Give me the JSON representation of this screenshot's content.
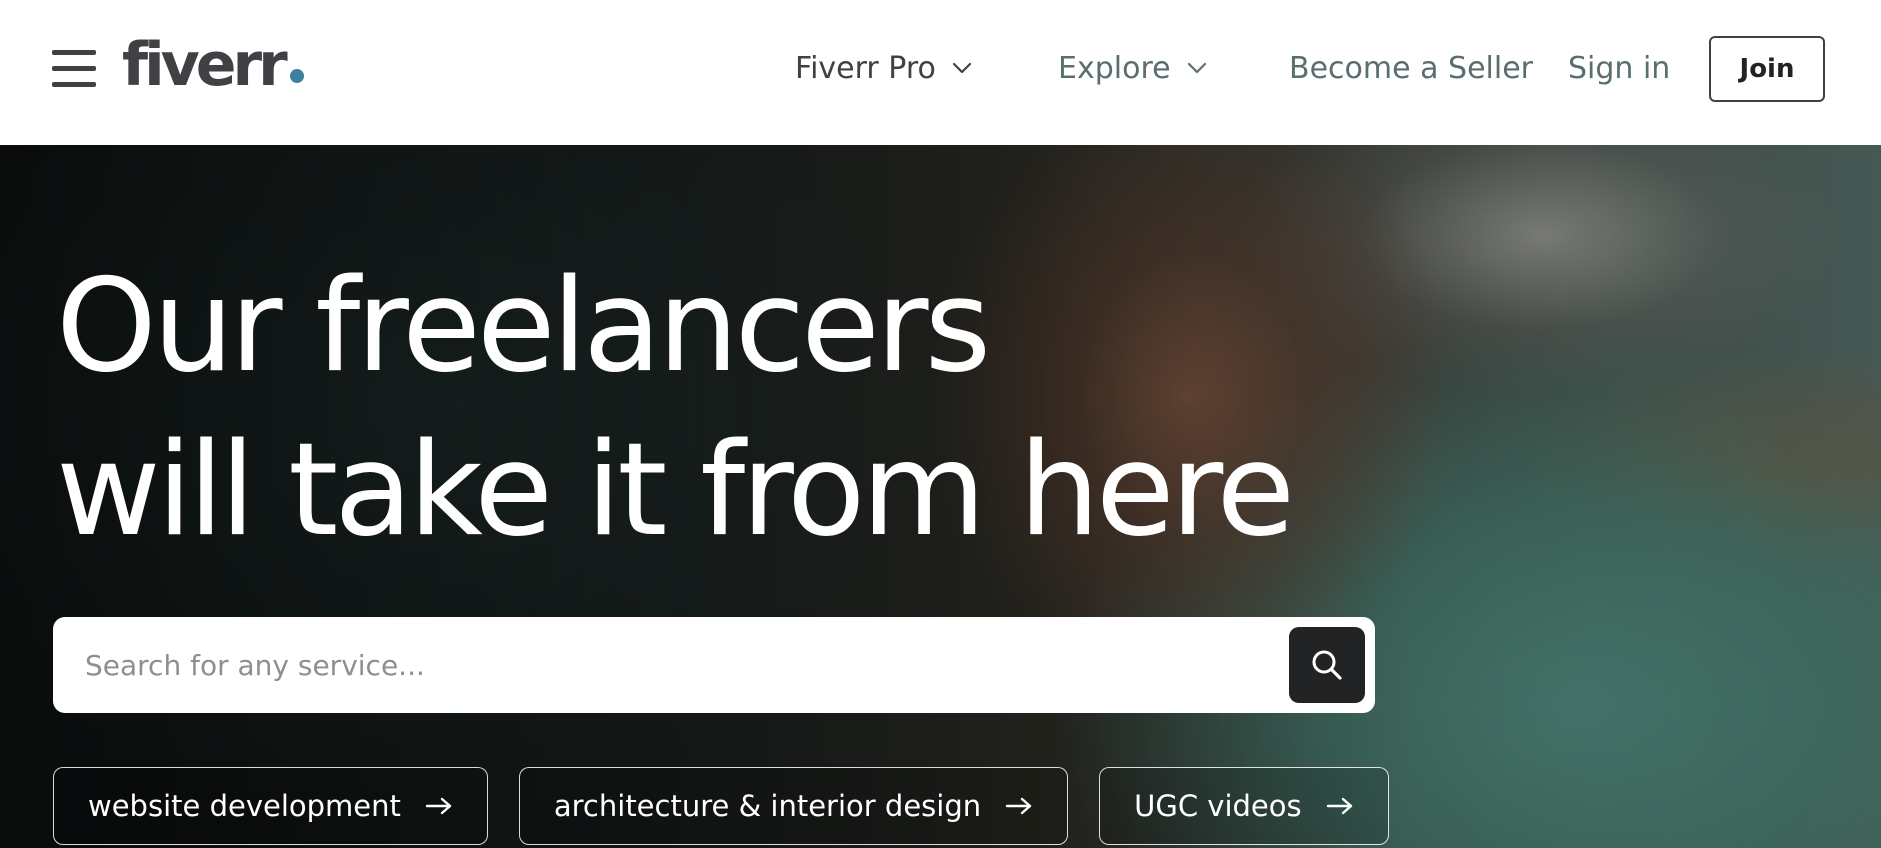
{
  "header": {
    "menu_icon": "hamburger-menu-icon",
    "logo": {
      "text": "fiverr",
      "dot_color": "#3f7f9e"
    },
    "nav": {
      "fiverr_pro": "Fiverr Pro",
      "explore": "Explore",
      "become_seller": "Become a Seller",
      "sign_in": "Sign in",
      "join": "Join"
    }
  },
  "hero": {
    "headline_line1": "Our freelancers",
    "headline_line2": "will take it from here",
    "search": {
      "placeholder": "Search for any service...",
      "value": "",
      "button_icon": "search-icon"
    },
    "chips": [
      {
        "label": "website development",
        "icon": "arrow-right-icon"
      },
      {
        "label": "architecture & interior design",
        "icon": "arrow-right-icon"
      },
      {
        "label": "UGC videos",
        "icon": "arrow-right-icon"
      }
    ]
  },
  "colors": {
    "text_dark": "#404145",
    "text_muted": "#5b6e6e",
    "search_button": "#222325"
  }
}
